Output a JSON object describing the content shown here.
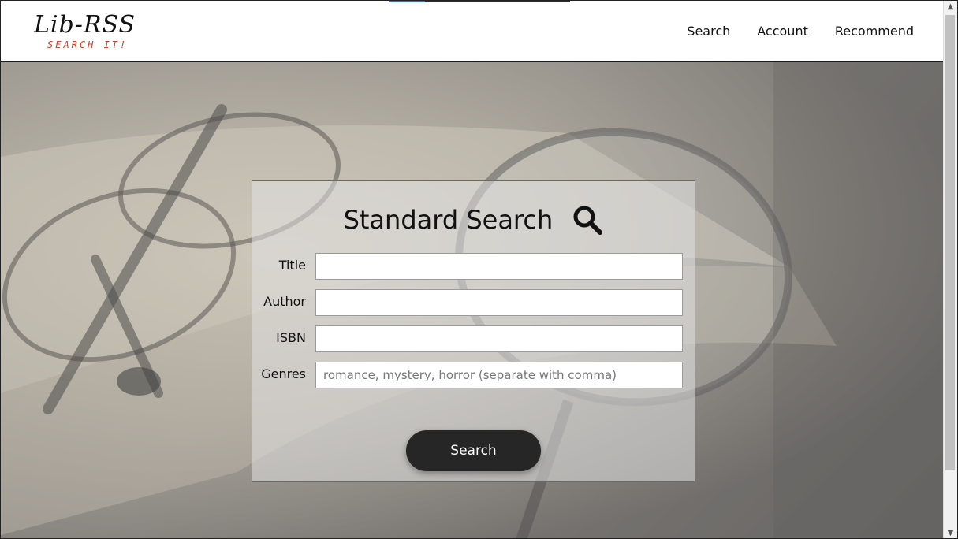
{
  "header": {
    "logo_main": "Lib-RSS",
    "logo_sub": "SEARCH IT!",
    "nav": [
      {
        "label": "Search"
      },
      {
        "label": "Account"
      },
      {
        "label": "Recommend"
      }
    ]
  },
  "search_panel": {
    "title": "Standard Search",
    "title_icon": "search-icon",
    "fields": [
      {
        "label": "Title",
        "value": "",
        "placeholder": ""
      },
      {
        "label": "Author",
        "value": "",
        "placeholder": ""
      },
      {
        "label": "ISBN",
        "value": "",
        "placeholder": ""
      },
      {
        "label": "Genres",
        "value": "",
        "placeholder": "romance, mystery, horror (separate with comma)"
      }
    ],
    "submit_label": "Search"
  },
  "colors": {
    "header_bg": "#ffffff",
    "accent_logo": "#c8442a",
    "button_bg": "#262626",
    "button_text": "#ffffff"
  },
  "scrollbar": {
    "up_icon": "chevron-up-icon",
    "down_icon": "chevron-down-icon"
  }
}
